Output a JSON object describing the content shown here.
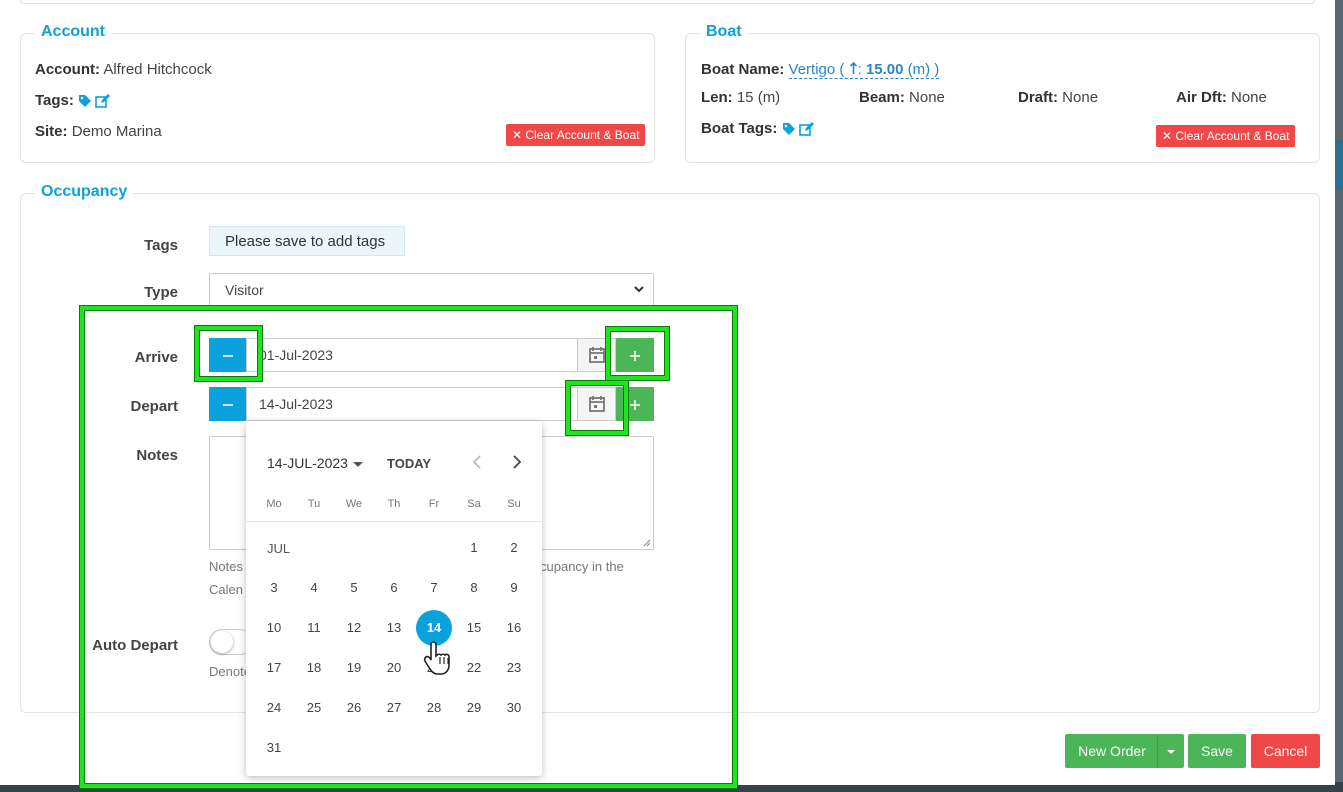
{
  "account": {
    "legend": "Account",
    "account_label": "Account:",
    "account_value": "Alfred Hitchcock",
    "tags_label": "Tags:",
    "site_label": "Site:",
    "site_value": "Demo Marina",
    "clear_button": "✕ Clear Account & Boat"
  },
  "boat": {
    "legend": "Boat",
    "name_label": "Boat Name:",
    "name_link_prefix": "Vertigo ( ",
    "name_link_len": "15.00",
    "name_link_suffix": " (m) )",
    "len_label": "Len:",
    "len_value": "15 (m)",
    "beam_label": "Beam:",
    "beam_value": "None",
    "draft_label": "Draft:",
    "draft_value": "None",
    "airdft_label": "Air Dft:",
    "airdft_value": "None",
    "tags_label": "Boat Tags:",
    "clear_button": "✕ Clear Account & Boat"
  },
  "occupancy": {
    "legend": "Occupancy",
    "tags_label": "Tags",
    "tags_note": "Please save to add tags",
    "type_label": "Type",
    "type_value": "Visitor",
    "arrive_label": "Arrive",
    "arrive_value": "01-Jul-2023",
    "depart_label": "Depart",
    "depart_value": "14-Jul-2023",
    "notes_label": "Notes",
    "notes_help_1": "Notes",
    "notes_help_1b": "cupancy in the",
    "notes_help_2": "Calen",
    "auto_depart_label": "Auto Depart",
    "auto_depart_help": "Denote"
  },
  "datepicker": {
    "header": "14-JUL-2023",
    "today": "TODAY",
    "weekdays": [
      "Mo",
      "Tu",
      "We",
      "Th",
      "Fr",
      "Sa",
      "Su"
    ],
    "month": "JUL",
    "selected_day": "14",
    "days": [
      "1",
      "2",
      "3",
      "4",
      "5",
      "6",
      "7",
      "8",
      "9",
      "10",
      "11",
      "12",
      "13",
      "14",
      "15",
      "16",
      "17",
      "18",
      "19",
      "20",
      "21",
      "22",
      "23",
      "24",
      "25",
      "26",
      "27",
      "28",
      "29",
      "30",
      "31"
    ]
  },
  "footer": {
    "new_order": "New Order",
    "save": "Save",
    "cancel": "Cancel"
  },
  "colors": {
    "accent": "#0aa1dd",
    "green": "#4bb557",
    "red": "#f04848",
    "highlight": "#1ee61e"
  },
  "icons": {
    "tag": "tag-icon",
    "edit": "edit-icon",
    "calendar": "calendar-icon",
    "minus": "minus-icon",
    "plus": "plus-icon"
  }
}
